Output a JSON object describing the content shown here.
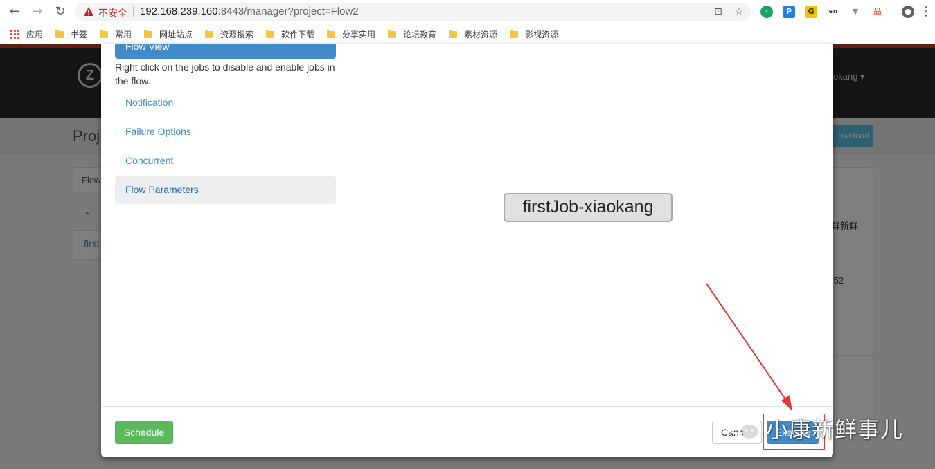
{
  "browser": {
    "security_label": "不安全",
    "url_host": "192.168.239.160",
    "url_rest": ":8443/manager?project=Flow2",
    "bookmarks": [
      "应用",
      "书签",
      "常用",
      "网址站点",
      "资源搜索",
      "软件下载",
      "分享实用",
      "论坛教育",
      "素材资源",
      "影视资源"
    ]
  },
  "background_page": {
    "user_name_fragment": "okang",
    "project_title_fragment": "Proj",
    "download_label_fragment": "ownload",
    "tab_fragment": "Flow",
    "flow_link_fragment": "first",
    "right_text_1": "鲜新鲜",
    "right_text_2": ":52"
  },
  "modal": {
    "flow_view_label": "Flow View",
    "hint": "Right click on the jobs to disable and enable jobs in the flow.",
    "nav_items": [
      "Notification",
      "Failure Options",
      "Concurrent",
      "Flow Parameters"
    ],
    "active_nav": "Flow Parameters",
    "job_node_label": "firstJob-xiaokang",
    "schedule_label": "Schedule",
    "cancel_label": "Canc",
    "execute_label": "Execute"
  },
  "watermark": {
    "text": "小康新鲜事儿"
  },
  "colors": {
    "primary": "#428bca",
    "success": "#5cb85c",
    "annotation_red": "#e53935"
  }
}
